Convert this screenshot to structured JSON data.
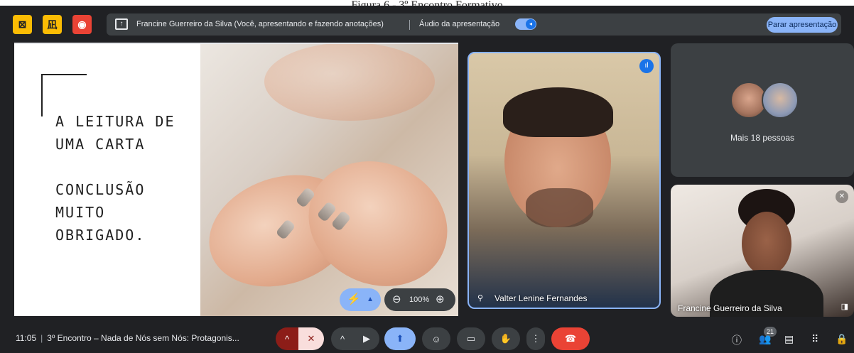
{
  "caption": "Figura 6 - 3º Encontro Formativo",
  "topbar": {
    "presenter_text": "Francine Guerreiro da Silva (Você, apresentando e fazendo anotações)",
    "audio_label": "Áudio da apresentação",
    "stop_label": "Parar apresentação"
  },
  "slide": {
    "lines": [
      "A LEITURA DE",
      "UMA CARTA",
      "",
      "CONCLUSÃO",
      "MUITO",
      "OBRIGADO."
    ],
    "zoom_level": "100%"
  },
  "participants": {
    "main_name": "Valter Lenine Fernandes",
    "more_label": "Mais 18 pessoas",
    "self_name": "Francine Guerreiro da Silva",
    "count": "21"
  },
  "bottombar": {
    "time": "11:05",
    "meeting_title": "3º Encontro – Nada de Nós sem Nós: Protagonis..."
  },
  "colors": {
    "background": "#202124",
    "accent": "#8ab4f8",
    "danger": "#ea4335",
    "warning": "#fbbc04"
  }
}
